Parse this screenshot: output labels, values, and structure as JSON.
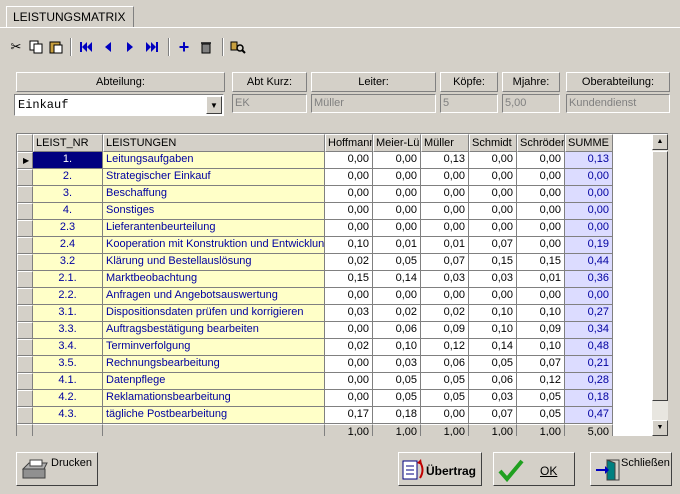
{
  "tab": {
    "title": "LEISTUNGSMATRIX"
  },
  "toolbar": {
    "icons": [
      "cut-icon",
      "copy-icon",
      "paste-icon",
      "first-record-icon",
      "prev-record-icon",
      "next-record-icon",
      "last-record-icon",
      "add-icon",
      "delete-icon",
      "search-icon"
    ]
  },
  "header": {
    "abteilung_label": "Abteilung:",
    "abteilung_value": "Einkauf",
    "abtkurz_label": "Abt Kurz:",
    "abtkurz_value": "EK",
    "leiter_label": "Leiter:",
    "leiter_value": "Müller",
    "koepfe_label": "Köpfe:",
    "koepfe_value": "5",
    "mjahre_label": "Mjahre:",
    "mjahre_value": "5,00",
    "oberabteilung_label": "Oberabteilung:",
    "oberabteilung_value": "Kundendienst"
  },
  "grid": {
    "columns": [
      "LEIST_NR",
      "LEISTUNGEN",
      "Hoffmann",
      "Meier-Lüb",
      "Müller",
      "Schmidt",
      "Schröder",
      "SUMME"
    ],
    "rows": [
      {
        "nr": "1.",
        "leistung": "Leitungsaufgaben",
        "v": [
          "0,00",
          "0,00",
          "0,13",
          "0,00",
          "0,00"
        ],
        "sum": "0,13"
      },
      {
        "nr": "2.",
        "leistung": "Strategischer Einkauf",
        "v": [
          "0,00",
          "0,00",
          "0,00",
          "0,00",
          "0,00"
        ],
        "sum": "0,00"
      },
      {
        "nr": "3.",
        "leistung": "Beschaffung",
        "v": [
          "0,00",
          "0,00",
          "0,00",
          "0,00",
          "0,00"
        ],
        "sum": "0,00"
      },
      {
        "nr": "4.",
        "leistung": "Sonstiges",
        "v": [
          "0,00",
          "0,00",
          "0,00",
          "0,00",
          "0,00"
        ],
        "sum": "0,00"
      },
      {
        "nr": "2.3",
        "leistung": "Lieferantenbeurteilung",
        "v": [
          "0,00",
          "0,00",
          "0,00",
          "0,00",
          "0,00"
        ],
        "sum": "0,00"
      },
      {
        "nr": "2.4",
        "leistung": "Kooperation mit Konstruktion und Entwicklung",
        "v": [
          "0,10",
          "0,01",
          "0,01",
          "0,07",
          "0,00"
        ],
        "sum": "0,19"
      },
      {
        "nr": "3.2",
        "leistung": "Klärung und Bestellauslösung",
        "v": [
          "0,02",
          "0,05",
          "0,07",
          "0,15",
          "0,15"
        ],
        "sum": "0,44"
      },
      {
        "nr": "2.1.",
        "leistung": "Marktbeobachtung",
        "v": [
          "0,15",
          "0,14",
          "0,03",
          "0,03",
          "0,01"
        ],
        "sum": "0,36"
      },
      {
        "nr": "2.2.",
        "leistung": "Anfragen und Angebotsauswertung",
        "v": [
          "0,00",
          "0,00",
          "0,00",
          "0,00",
          "0,00"
        ],
        "sum": "0,00"
      },
      {
        "nr": "3.1.",
        "leistung": "Dispositionsdaten prüfen und korrigieren",
        "v": [
          "0,03",
          "0,02",
          "0,02",
          "0,10",
          "0,10"
        ],
        "sum": "0,27"
      },
      {
        "nr": "3.3.",
        "leistung": "Auftragsbestätigung bearbeiten",
        "v": [
          "0,00",
          "0,06",
          "0,09",
          "0,10",
          "0,09"
        ],
        "sum": "0,34"
      },
      {
        "nr": "3.4.",
        "leistung": "Terminverfolgung",
        "v": [
          "0,02",
          "0,10",
          "0,12",
          "0,14",
          "0,10"
        ],
        "sum": "0,48"
      },
      {
        "nr": "3.5.",
        "leistung": "Rechnungsbearbeitung",
        "v": [
          "0,00",
          "0,03",
          "0,06",
          "0,05",
          "0,07"
        ],
        "sum": "0,21"
      },
      {
        "nr": "4.1.",
        "leistung": "Datenpflege",
        "v": [
          "0,00",
          "0,05",
          "0,05",
          "0,06",
          "0,12"
        ],
        "sum": "0,28"
      },
      {
        "nr": "4.2.",
        "leistung": "Reklamationsbearbeitung",
        "v": [
          "0,00",
          "0,05",
          "0,05",
          "0,03",
          "0,05"
        ],
        "sum": "0,18"
      },
      {
        "nr": "4.3.",
        "leistung": "tägliche Postbearbeitung",
        "v": [
          "0,17",
          "0,18",
          "0,00",
          "0,07",
          "0,05"
        ],
        "sum": "0,47"
      }
    ],
    "totals": [
      "1,00",
      "1,00",
      "1,00",
      "1,00",
      "1,00",
      "5,00"
    ]
  },
  "buttons": {
    "drucken": "Drucken",
    "uebertrag": "Übertrag",
    "ok": "OK",
    "schliessen": "Schließen"
  }
}
